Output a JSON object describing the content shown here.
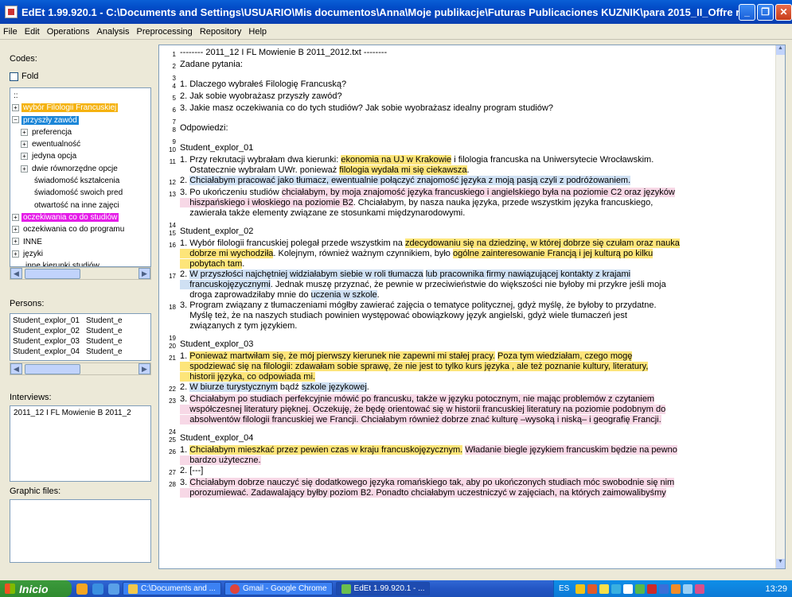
{
  "window": {
    "title": "EdEt 1.99.920.1   - C:\\Documents and Settings\\USUARIO\\Mis documentos\\Anna\\Moje publikacje\\Futuras Publicaciones KUZNIK\\para 2015_II_Offre r..."
  },
  "menu": [
    "File",
    "Edit",
    "Operations",
    "Analysis",
    "Preprocessing",
    "Repository",
    "Help"
  ],
  "left": {
    "codes_label": "Codes:",
    "fold_label": "Fold",
    "tree": [
      {
        "label": "::",
        "exp": "",
        "indent": 0,
        "color": ""
      },
      {
        "label": "wybór Filologii Francuskiej",
        "exp": "+",
        "indent": 0,
        "color": "#f5b20f"
      },
      {
        "label": "przyszły zawód",
        "exp": "−",
        "indent": 0,
        "color": "#1b86d8"
      },
      {
        "label": "preferencja",
        "exp": "+",
        "indent": 1,
        "color": ""
      },
      {
        "label": "ewentualność",
        "exp": "+",
        "indent": 1,
        "color": ""
      },
      {
        "label": "jedyna opcja",
        "exp": "+",
        "indent": 1,
        "color": ""
      },
      {
        "label": "dwie równorzędne opcje",
        "exp": "+",
        "indent": 1,
        "color": ""
      },
      {
        "label": "świadomość kształcenia",
        "exp": "",
        "indent": 2,
        "color": ""
      },
      {
        "label": "świadomość swoich pred",
        "exp": "",
        "indent": 2,
        "color": ""
      },
      {
        "label": "otwartość na inne zajęci",
        "exp": "",
        "indent": 2,
        "color": ""
      },
      {
        "label": "oczekiwania co do studiów",
        "exp": "+",
        "indent": 0,
        "color": "#e51ce8"
      },
      {
        "label": "oczekiwania co do programu",
        "exp": "+",
        "indent": 0,
        "color": ""
      },
      {
        "label": "INNE",
        "exp": "+",
        "indent": 0,
        "color": ""
      },
      {
        "label": "języki",
        "exp": "+",
        "indent": 0,
        "color": ""
      },
      {
        "label": "inne kierunki studiów",
        "exp": "",
        "indent": 1,
        "color": ""
      }
    ],
    "persons_label": "Persons:",
    "persons": [
      [
        "Student_explor_01",
        "Student_e"
      ],
      [
        "Student_explor_02",
        "Student_e"
      ],
      [
        "Student_explor_03",
        "Student_e"
      ],
      [
        "Student_explor_04",
        "Student_e"
      ]
    ],
    "interviews_label": "Interviews:",
    "interviews": [
      "2011_12 I FL Mowienie B 2011_2"
    ],
    "graphic_label": "Graphic files:"
  },
  "lines": [
    {
      "n": "1",
      "segs": [
        {
          "t": "-------- 2011_12 I FL Mowienie B 2011_2012.txt --------",
          "c": ""
        }
      ]
    },
    {
      "n": "2",
      "segs": [
        {
          "t": "Zadane pytania:",
          "c": ""
        }
      ]
    },
    {
      "n": "3",
      "segs": [
        {
          "t": " ",
          "c": ""
        }
      ]
    },
    {
      "n": "4",
      "segs": [
        {
          "t": "1. Dlaczego wybrałeś Filologię Francuską?",
          "c": ""
        }
      ]
    },
    {
      "n": "5",
      "segs": [
        {
          "t": "2. Jak sobie wyobrażasz przyszły zawód?",
          "c": ""
        }
      ]
    },
    {
      "n": "6",
      "segs": [
        {
          "t": "3. Jakie masz oczekiwania co do tych studiów? Jak sobie wyobrażasz idealny program studiów?",
          "c": ""
        }
      ]
    },
    {
      "n": "7",
      "segs": [
        {
          "t": " ",
          "c": ""
        }
      ]
    },
    {
      "n": "8",
      "segs": [
        {
          "t": "Odpowiedzi:",
          "c": ""
        }
      ]
    },
    {
      "n": "9",
      "segs": [
        {
          "t": " ",
          "c": ""
        }
      ]
    },
    {
      "n": "10",
      "segs": [
        {
          "t": "Student_explor_01",
          "c": ""
        }
      ]
    },
    {
      "n": "11",
      "segs": [
        {
          "t": "1. Przy rekrutacji wybrałam dwa kierunki: ",
          "c": ""
        },
        {
          "t": "ekonomia na UJ w Krakowie",
          "c": "y"
        },
        {
          "t": " i filologia francuska na Uniwersytecie Wrocławskim.\n    Ostatecznie wybrałam UWr. ponieważ ",
          "c": ""
        },
        {
          "t": "filologia wydała mi się ciekawsza",
          "c": "y"
        },
        {
          "t": ".",
          "c": ""
        }
      ]
    },
    {
      "n": "12",
      "segs": [
        {
          "t": "2. ",
          "c": ""
        },
        {
          "t": "Chciałabym pracować jako tłumacz",
          "c": "b"
        },
        {
          "t": ", ewentualnie połączyć znajomość języka z moją pasją czyli z podróżowaniem.",
          "c": "b"
        }
      ]
    },
    {
      "n": "13",
      "segs": [
        {
          "t": "3. Po ukończeniu studiów ",
          "c": ""
        },
        {
          "t": "chciałabym, by moja znajomość języka francuskiego i angielskiego była na poziomie C2 oraz języków\n    hiszpańskiego i włoskiego na poziomie B2",
          "c": "p"
        },
        {
          "t": ". Chciałabym, by nasza nauka języka, przede wszystkim języka francuskiego,\n    zawierała także elementy związane ze stosunkami międzynarodowymi.",
          "c": ""
        }
      ]
    },
    {
      "n": "14",
      "segs": [
        {
          "t": " ",
          "c": ""
        }
      ]
    },
    {
      "n": "15",
      "segs": [
        {
          "t": "Student_explor_02",
          "c": ""
        }
      ]
    },
    {
      "n": "16",
      "segs": [
        {
          "t": "1. Wybór filologii francuskiej polegał przede wszystkim na ",
          "c": ""
        },
        {
          "t": "zdecydowaniu się na dziedzinę, w której dobrze się czułam oraz nauka\n    dobrze mi wychodziła",
          "c": "y"
        },
        {
          "t": ". Kolejnym, również ważnym czynnikiem, było ",
          "c": ""
        },
        {
          "t": "ogólne zainteresowanie Francją i jej kulturą po kilku\n    pobytach tam",
          "c": "y"
        },
        {
          "t": ".",
          "c": ""
        }
      ]
    },
    {
      "n": "17",
      "segs": [
        {
          "t": "2. ",
          "c": ""
        },
        {
          "t": "W przyszłości najchętniej widziałabym siebie w roli tłumacza",
          "c": "b"
        },
        {
          "t": " ",
          "c": ""
        },
        {
          "t": "lub pracownika firmy nawiązującej kontakty z krajami\n    francuskojęzycznymi",
          "c": "b"
        },
        {
          "t": ". Jednak muszę przyznać, że pewnie w przeciwieństwie do większości nie byłoby mi przykre jeśli moja\n    droga zaprowadziłaby mnie do ",
          "c": ""
        },
        {
          "t": "uczenia w szkole",
          "c": "b"
        },
        {
          "t": ".",
          "c": ""
        }
      ]
    },
    {
      "n": "18",
      "segs": [
        {
          "t": "3. Program związany z tłumaczeniami mógłby zawierać zajęcia o tematyce politycznej, gdyż myślę, że byłoby to przydatne.\n    Myślę też, że na naszych studiach powinien występować obowiązkowy język angielski, gdyż wiele tłumaczeń jest\n    związanych z tym językiem.",
          "c": ""
        }
      ]
    },
    {
      "n": "19",
      "segs": [
        {
          "t": " ",
          "c": ""
        }
      ]
    },
    {
      "n": "20",
      "segs": [
        {
          "t": "Student_explor_03",
          "c": ""
        }
      ]
    },
    {
      "n": "21",
      "segs": [
        {
          "t": "1. ",
          "c": ""
        },
        {
          "t": "Ponieważ martwiłam się, że mój pierwszy kierunek nie zapewni mi stałej pracy.",
          "c": "y"
        },
        {
          "t": " ",
          "c": ""
        },
        {
          "t": "Poza tym wiedziałam, czego mogę\n    spodziewać się na filologii: zdawałam sobie sprawę, że nie jest to tylko kurs języka , ale też poznanie kultury, literatury,\n    historii języka, co odpowiada mi.",
          "c": "y"
        }
      ]
    },
    {
      "n": "22",
      "segs": [
        {
          "t": "2. ",
          "c": ""
        },
        {
          "t": "W biurze turystycznym",
          "c": "b"
        },
        {
          "t": " bądź ",
          "c": ""
        },
        {
          "t": "szkole językowej",
          "c": "b"
        },
        {
          "t": ".",
          "c": ""
        }
      ]
    },
    {
      "n": "23",
      "segs": [
        {
          "t": "3. ",
          "c": ""
        },
        {
          "t": "Chciałabym po studiach perfekcyjnie mówić po francusku, także w języku potocznym, nie mając problemów z czytaniem\n    współczesnej literatury pięknej. Oczekuję, że będę orientować się w historii francuskiej literatury na poziomie podobnym do\n    absolwentów filologii francuskiej we Francji. Chciałabym również dobrze znać kulturę –wysoką i niską– i geografię Francji.",
          "c": "p"
        }
      ]
    },
    {
      "n": "24",
      "segs": [
        {
          "t": " ",
          "c": ""
        }
      ]
    },
    {
      "n": "25",
      "segs": [
        {
          "t": "Student_explor_04",
          "c": ""
        }
      ]
    },
    {
      "n": "26",
      "segs": [
        {
          "t": "1. ",
          "c": ""
        },
        {
          "t": "Chciałabym mieszkać przez pewien czas w kraju francuskojęzycznym.",
          "c": "y"
        },
        {
          "t": " ",
          "c": ""
        },
        {
          "t": "Władanie biegle językiem francuskim będzie na pewno\n    bardzo użyteczne.",
          "c": "p"
        }
      ]
    },
    {
      "n": "27",
      "segs": [
        {
          "t": "2. [---]",
          "c": ""
        }
      ]
    },
    {
      "n": "28",
      "segs": [
        {
          "t": "3. ",
          "c": ""
        },
        {
          "t": "Chciałabym dobrze nauczyć się dodatkowego języka romańskiego tak, aby po ukończonych studiach móc swobodnie się nim\n    porozumiewać. Zadawalający byłby poziom B2. Ponadto chciałabym uczestniczyć w zajęciach, na których zaimowalibyśmy",
          "c": "p"
        }
      ]
    }
  ],
  "taskbar": {
    "start": "Inicio",
    "tasks": [
      "C:\\Documents and ...",
      "Gmail - Google Chrome",
      "EdEt 1.99.920.1 - ..."
    ],
    "lang": "ES",
    "clock": "13:29"
  },
  "colors": {
    "yellow": "#fde57a",
    "pink": "#f7d8e6",
    "blue": "#cfe0f3"
  }
}
